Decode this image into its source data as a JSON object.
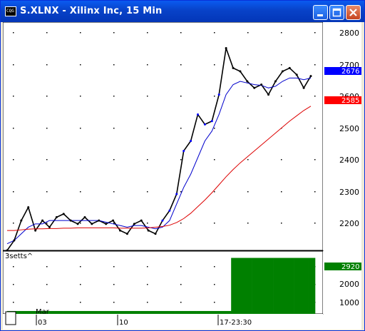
{
  "window": {
    "title": "S.XLNX - Xilinx Inc, 15 Min",
    "icon": "cqg-icon",
    "icon_text": "CQG"
  },
  "price_chart": {
    "y_ticks": [
      "2800",
      "2700",
      "2600",
      "2500",
      "2400",
      "2300",
      "2200"
    ],
    "last_price": "2676",
    "ma_value": "2585",
    "last_price_color": "#0000ff",
    "ma_color": "#ff0000"
  },
  "volume_panel": {
    "label": "3setts^",
    "y_ticks": [
      "2000",
      "1000"
    ],
    "last_value": "2920",
    "last_value_color": "#008000"
  },
  "x_axis": {
    "month": "Mar",
    "labels": [
      "03",
      "10",
      "17-23:30"
    ]
  },
  "chart_data": [
    {
      "type": "line",
      "x": [
        0,
        10,
        20,
        30,
        40,
        50,
        60,
        70,
        80,
        90,
        100,
        110,
        120,
        130,
        140,
        150,
        160,
        170,
        180,
        190,
        200,
        210,
        220,
        230,
        240,
        250,
        260,
        270,
        280,
        290,
        300,
        310,
        320,
        330,
        340,
        350,
        360,
        370,
        380,
        390,
        400,
        410,
        420,
        430
      ],
      "series": [
        {
          "values": [
            2150,
            2180,
            2240,
            2280,
            2210,
            2240,
            2220,
            2250,
            2260,
            2240,
            2230,
            2250,
            2230,
            2240,
            2230,
            2240,
            2210,
            2200,
            2230,
            2240,
            2210,
            2200,
            2240,
            2270,
            2320,
            2450,
            2480,
            2560,
            2530,
            2540,
            2620,
            2760,
            2700,
            2690,
            2660,
            2640,
            2650,
            2620,
            2660,
            2690,
            2700,
            2680,
            2640,
            2676
          ]
        },
        {
          "values": [
            2170,
            2180,
            2200,
            2220,
            2230,
            2230,
            2240,
            2240,
            2240,
            2240,
            2240,
            2240,
            2240,
            2240,
            2235,
            2230,
            2225,
            2220,
            2225,
            2225,
            2220,
            2215,
            2220,
            2240,
            2290,
            2340,
            2380,
            2430,
            2480,
            2510,
            2560,
            2620,
            2650,
            2660,
            2655,
            2650,
            2648,
            2640,
            2645,
            2660,
            2670,
            2670,
            2665,
            2670
          ]
        },
        {
          "values": [
            2210,
            2210,
            2212,
            2214,
            2215,
            2215,
            2216,
            2216,
            2217,
            2217,
            2218,
            2218,
            2218,
            2218,
            2218,
            2218,
            2217,
            2217,
            2217,
            2217,
            2218,
            2220,
            2222,
            2226,
            2234,
            2246,
            2262,
            2282,
            2302,
            2324,
            2348,
            2372,
            2394,
            2414,
            2432,
            2450,
            2468,
            2486,
            2504,
            2522,
            2540,
            2556,
            2572,
            2585
          ]
        }
      ],
      "ylim": [
        2150,
        2830
      ]
    },
    {
      "type": "bar",
      "series": [
        {
          "values": [
            150,
            150,
            150,
            150,
            150,
            150,
            150,
            150,
            150,
            150,
            150,
            150,
            150,
            150,
            150,
            150,
            150,
            150,
            150,
            150,
            150,
            150,
            150,
            150,
            150,
            150,
            150,
            150,
            150,
            150,
            150,
            150,
            2920,
            2920,
            2920,
            2920,
            2920,
            2920,
            2920,
            2920,
            2920,
            2920,
            2920,
            2920
          ]
        }
      ],
      "ylim": [
        0,
        3200
      ]
    }
  ]
}
